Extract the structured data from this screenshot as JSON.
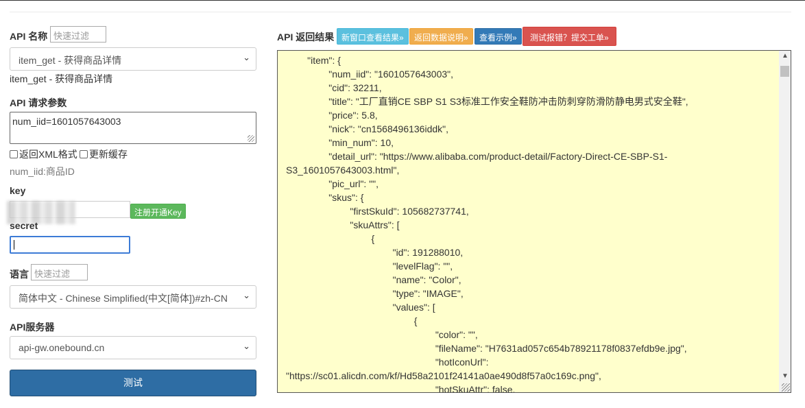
{
  "left": {
    "api_name_label": "API 名称",
    "api_filter_placeholder": "快速过滤",
    "api_select_value": "item_get - 获得商品详情",
    "api_desc": "item_get - 获得商品详情",
    "params_label": "API 请求参数",
    "params_value": "num_iid=1601057643003",
    "xml_label": "返回XML格式",
    "cache_label": "更新缓存",
    "param_hint": "num_iid:商品ID",
    "key_label": "key",
    "register_key_label": "注册开通Key",
    "secret_label": "secret",
    "lang_label": "语言",
    "lang_filter_placeholder": "快速过滤",
    "lang_select_value": "简体中文 - Chinese Simplified(中文[简体])#zh-CN",
    "server_label": "API服务器",
    "server_select_value": "api-gw.onebound.cn",
    "test_button": "测试"
  },
  "right": {
    "result_label": "API 返回结果",
    "btn_new_window": "新窗口查看结果»",
    "btn_data_desc": "返回数据说明»",
    "btn_example": "查看示例»",
    "btn_report": "测试报错？提交工单»"
  },
  "output_lines": [
    "        \"item\": {",
    "                \"num_iid\": \"1601057643003\",",
    "                \"cid\": 32211,",
    "                \"title\": \"工厂直销CE SBP S1 S3标准工作安全鞋防冲击防刺穿防滑防静电男式安全鞋\",",
    "                \"price\": 5.8,",
    "                \"nick\": \"cn1568496136iddk\",",
    "                \"min_num\": 10,",
    "                \"detail_url\": \"https://www.alibaba.com/product-detail/Factory-Direct-CE-SBP-S1-S3_1601057643003.html\",",
    "                \"pic_url\": \"\",",
    "                \"skus\": {",
    "                        \"firstSkuId\": 105682737741,",
    "                        \"skuAttrs\": [",
    "                                {",
    "                                        \"id\": 191288010,",
    "                                        \"levelFlag\": \"\",",
    "                                        \"name\": \"Color\",",
    "                                        \"type\": \"IMAGE\",",
    "                                        \"values\": [",
    "                                                {",
    "                                                        \"color\": \"\",",
    "                                                        \"fileName\": \"H7631ad057c654b78921178f0837efdb9e.jpg\",",
    "                                                        \"hotIconUrl\": \"https://sc01.alicdn.com/kf/Hd58a2101f24141a0ae490d8f57a0c169c.png\",",
    "                                                        \"hotSkuAttr\": false,"
  ],
  "icons": {
    "select_chevron": "chevron-down-icon",
    "scroll_up": "arrow-up-icon",
    "scroll_down": "arrow-down-icon"
  },
  "colors": {
    "output_bg": "#ffffcc",
    "test_button": "#2e6da4",
    "btn_info": "#5bc0de",
    "btn_warning": "#f0ad4e",
    "btn_primary": "#337ab7",
    "btn_danger": "#d9534f",
    "btn_success": "#5cb85c"
  }
}
